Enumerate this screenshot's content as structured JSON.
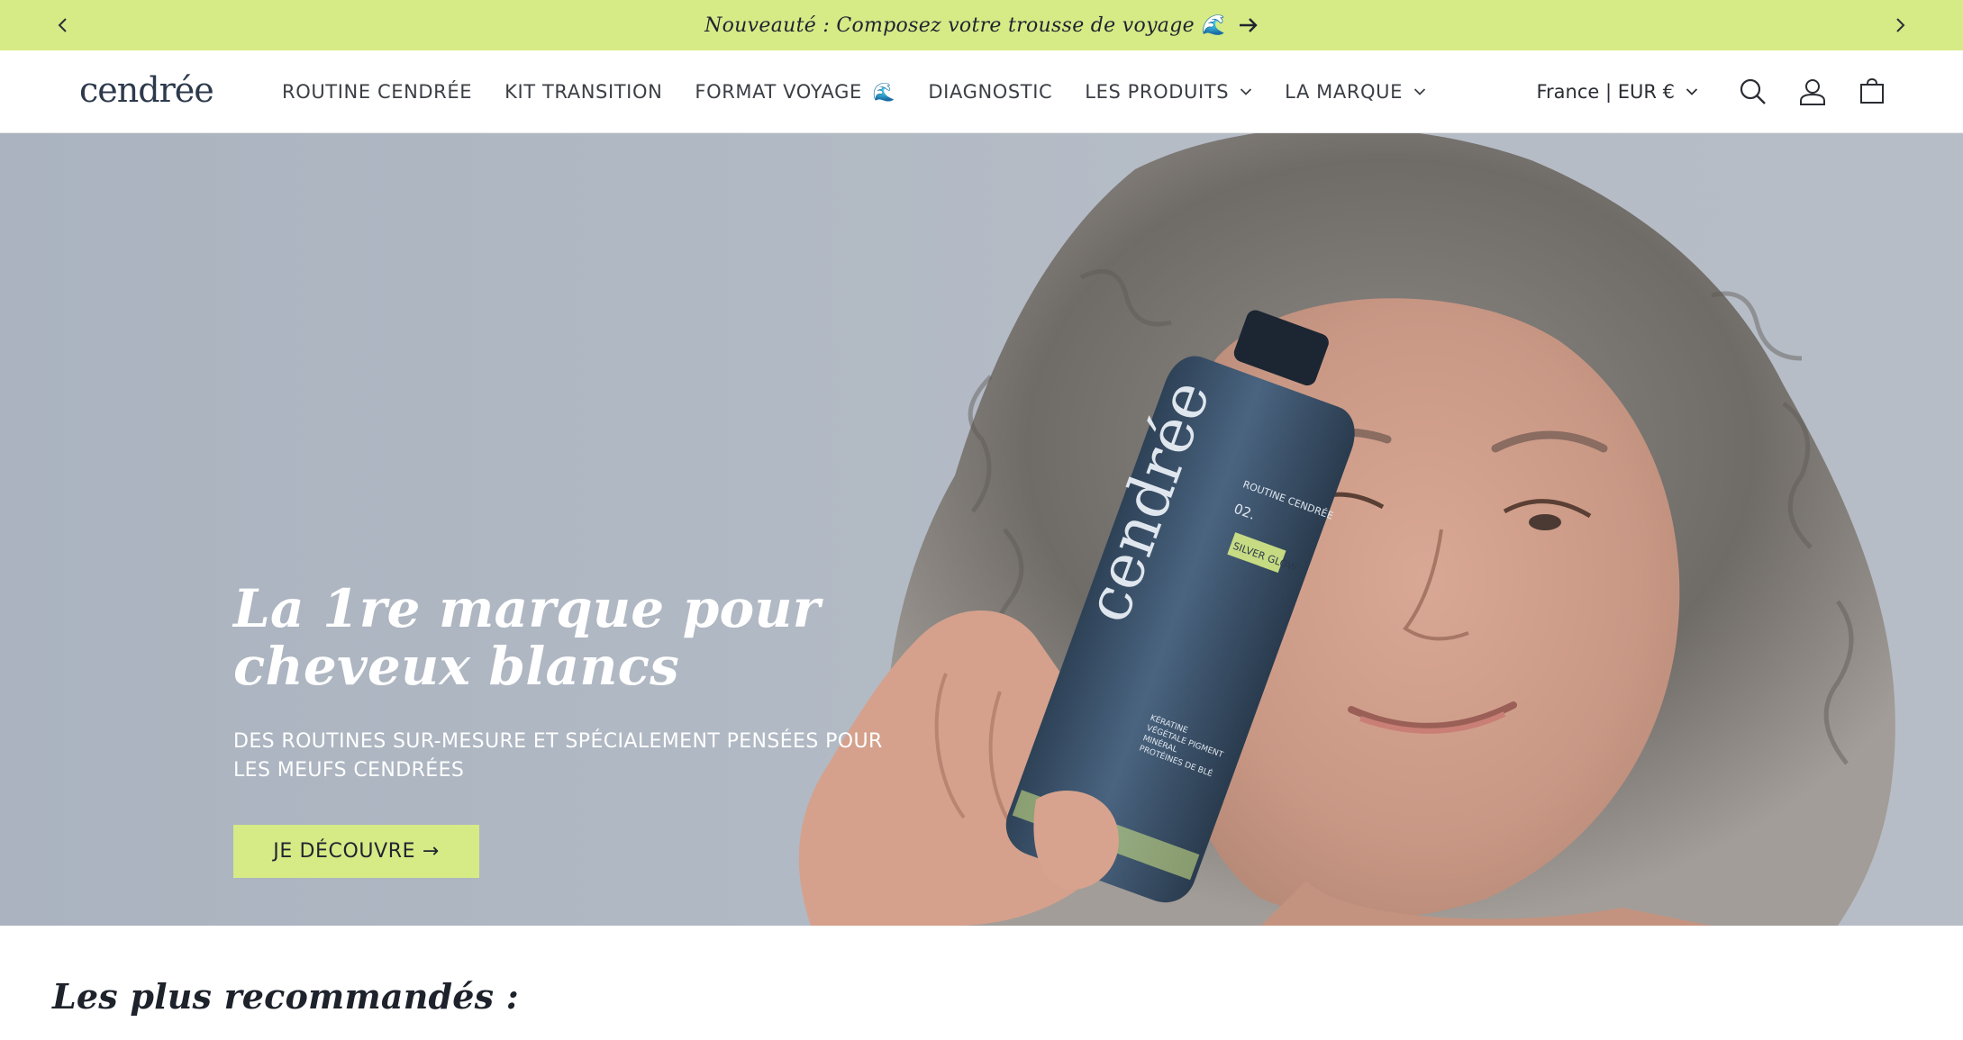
{
  "announcement": {
    "text": "Nouveauté : Composez votre trousse de voyage 🌊"
  },
  "header": {
    "logo": "cendrée",
    "nav": [
      {
        "label": "ROUTINE CENDRÉE"
      },
      {
        "label": "KIT TRANSITION"
      },
      {
        "label": "FORMAT VOYAGE",
        "emoji": "🌊"
      },
      {
        "label": "DIAGNOSTIC"
      },
      {
        "label": "LES PRODUITS",
        "dropdown": true
      },
      {
        "label": "LA MARQUE",
        "dropdown": true
      }
    ],
    "country_selector": "France | EUR €",
    "icons": [
      "search-icon",
      "account-icon",
      "cart-icon"
    ]
  },
  "hero": {
    "title": "La 1re marque pour cheveux blancs",
    "subtitle": "DES ROUTINES SUR-MESURE ET SPÉCIALEMENT PENSÉES POUR LES MEUFS CENDRÉES",
    "cta": "JE DÉCOUVRE →",
    "bottle": {
      "brand": "cendrée",
      "line1": "ROUTINE CENDRÉE",
      "line2": "02.",
      "product": "SILVER GLOW",
      "ingredients": "KÉRATINE VÉGÉTALE PIGMENT MINÉRAL PROTÉINES DE BLÉ"
    }
  },
  "section": {
    "title": "Les plus recommandés :"
  },
  "colors": {
    "accent": "#d6ea86",
    "hero_bg": "#b1b9c4",
    "bottle": "#3f566e"
  }
}
